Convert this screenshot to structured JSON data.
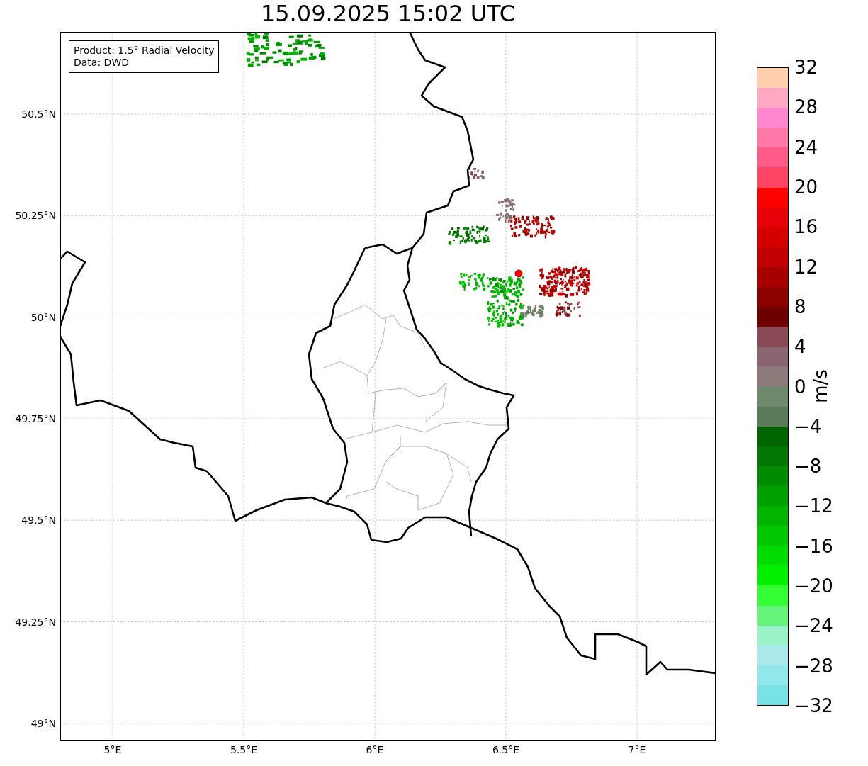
{
  "title": "15.09.2025 15:02 UTC",
  "info_box": {
    "lines": [
      "Product: 1.5° Radial Velocity",
      "Data: DWD"
    ]
  },
  "map": {
    "yticks": [
      "50.5°N",
      "50.25°N",
      "50°N",
      "49.75°N",
      "49.5°N",
      "49.25°N",
      "49°N"
    ],
    "xticks": [
      "5°E",
      "5.5°E",
      "6°E",
      "6.5°E",
      "7°E"
    ]
  },
  "colorbar": {
    "label": "m/s",
    "ticks": [
      "32",
      "28",
      "24",
      "20",
      "16",
      "12",
      "8",
      "4",
      "0",
      "−4",
      "−8",
      "−12",
      "−16",
      "−20",
      "−24",
      "−28",
      "−32"
    ],
    "bands": [
      {
        "color": "#ffcfae"
      },
      {
        "color": "#ffa9c5"
      },
      {
        "color": "#ff88d0"
      },
      {
        "color": "#ff78a8"
      },
      {
        "color": "#ff5b88"
      },
      {
        "color": "#ff4466"
      },
      {
        "color": "#ff0000"
      },
      {
        "color": "#e60008"
      },
      {
        "color": "#d40000"
      },
      {
        "color": "#c00000"
      },
      {
        "color": "#a80000"
      },
      {
        "color": "#8c0000"
      },
      {
        "color": "#6e0000"
      },
      {
        "color": "#8a4a55"
      },
      {
        "color": "#8a6570"
      },
      {
        "color": "#8c7a7a"
      },
      {
        "color": "#6d8a6d"
      },
      {
        "color": "#5a7a5a"
      },
      {
        "color": "#006400"
      },
      {
        "color": "#007800"
      },
      {
        "color": "#008c00"
      },
      {
        "color": "#00a000"
      },
      {
        "color": "#00b400"
      },
      {
        "color": "#00c800"
      },
      {
        "color": "#00dc00"
      },
      {
        "color": "#00f000"
      },
      {
        "color": "#33ff33"
      },
      {
        "color": "#66f57a"
      },
      {
        "color": "#99f2c8"
      },
      {
        "color": "#aaeaea"
      },
      {
        "color": "#90e8ea"
      },
      {
        "color": "#78e2e6"
      }
    ]
  }
}
